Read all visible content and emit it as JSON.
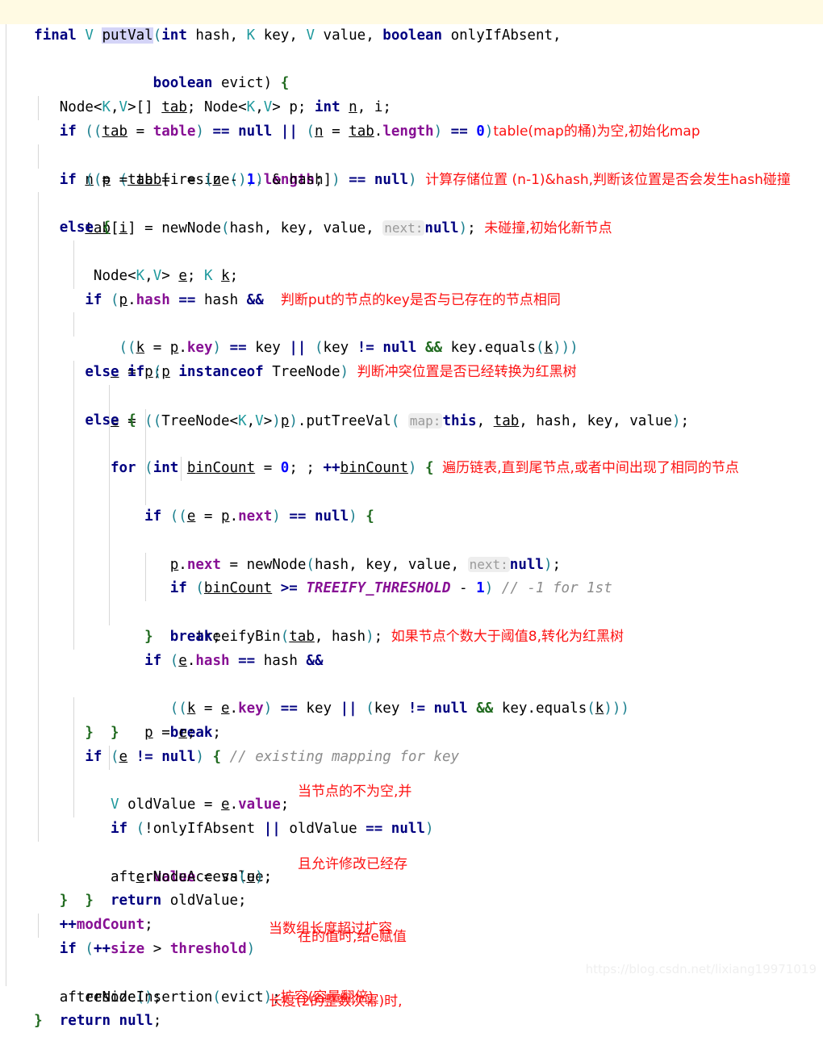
{
  "app": {
    "kind": "code-editor",
    "language": "Java",
    "theme": "IntelliJ Light",
    "watermark": "https://blog.csdn.net/lixiang19971019",
    "colors": {
      "background": "#ffffff",
      "caret_line": "#fffae3",
      "keyword": "#000080",
      "field": "#871094",
      "type_param": "#20999d",
      "number": "#0000ff",
      "comment": "#8c8c8c",
      "paren": "#1a7f8e",
      "brace": "#216b20",
      "inlay_hint_bg": "#eeeeee",
      "inlay_hint_text": "#9a9a9a",
      "selection": "#d4d4f7",
      "annotation_red": "#fd1212",
      "indent_guide": "#d7d7d7"
    }
  },
  "code": {
    "line_1": {
      "kw_final": "final",
      "type_v": "V",
      "name": "putVal",
      "open": "(",
      "kw_int": "int",
      "p1": "hash,",
      "type_k": "K",
      "p2": "key,",
      "type_v2": "V",
      "p3": "value,",
      "kw_boolean": "boolean",
      "p4": "onlyIfAbsent,"
    },
    "line_2": {
      "kw_boolean": "boolean",
      "p": "evict)",
      "brace": "{"
    },
    "line_3": {
      "t1": "Node<",
      "k": "K",
      "c1": ",",
      "v": "V",
      "c2": ">[]",
      "tab": "tab",
      "semi1": ";",
      "t2": "Node<",
      "k2": "K",
      "c3": ",",
      "v2": "V",
      "c4": ">",
      "p": "p",
      "semi2": ";",
      "kw_int": "int",
      "n": "n",
      "comma": ",",
      "i": "i",
      "semi3": ";"
    },
    "line_4": {
      "kw_if": "if",
      "o": "((",
      "tab": "tab",
      "eq": "=",
      "table": "table",
      "cl": ")",
      "eqeq": "==",
      "nul": "null",
      "or": "||",
      "o2": "(",
      "n": "n",
      "eq2": "=",
      "tab2": "tab",
      "dot": ".",
      "length": "length",
      "cl2": ")",
      "eqeq2": "==",
      "zero": "0",
      "cl3": ")",
      "note": "table(map的桶)为空,初始化map"
    },
    "line_5": {
      "n": "n",
      "eq": "=",
      "o": "(",
      "tab": "tab",
      "eq2": "=",
      "resize": "resize",
      "parens": "()",
      "cl": ")",
      "dot": ".",
      "length": "length",
      "semi": ";"
    },
    "line_6": {
      "kw_if": "if",
      "o": "((",
      "p": "p",
      "eq": "=",
      "tab": "tab",
      "br1": "[",
      "i": "i",
      "eq2": "=",
      "o2": "(",
      "n": "n",
      "minus": "-",
      "one": "1",
      "cl2": ")",
      "amp": "&",
      "hash": "hash",
      "br2": "]",
      "cl3": ")",
      "eqeq": "==",
      "nul": "null",
      "cl4": ")",
      "note": "计算存储位置 (n-1)&hash,判断该位置是否会发生hash碰撞"
    },
    "line_7": {
      "tab": "tab",
      "br1": "[",
      "i": "i",
      "br2": "]",
      "eq": "=",
      "newNode": "newNode",
      "o": "(",
      "args": "hash, key, value,",
      "hint": "next:",
      "nul": "null",
      "cl": ")",
      "semi": ";",
      "note": "未碰撞,初始化新节点"
    },
    "line_8": {
      "kw_else": "else",
      "brace": "{"
    },
    "line_9": {
      "t1": "Node<",
      "k": "K",
      "c1": ",",
      "v": "V",
      "c2": ">",
      "e": "e",
      "semi1": ";",
      "k2": "K",
      "kk": "k",
      "semi2": ";"
    },
    "line_10": {
      "kw_if": "if",
      "o": "(",
      "p": "p",
      "dot": ".",
      "hash": "hash",
      "eqeq": "==",
      "hash2": "hash",
      "and": "&&",
      "note": "判断put的节点的key是否与已存在的节点相同"
    },
    "line_11": {
      "o": "((",
      "k": "k",
      "eq": "=",
      "p": "p",
      "dot": ".",
      "key": "key",
      "cl": ")",
      "eqeq": "==",
      "key2": "key",
      "or": "||",
      "o2": "(",
      "key3": "key",
      "neq": "!=",
      "nul": "null",
      "and": "&&",
      "key4": "key",
      "dot2": ".",
      "equals": "equals",
      "o3": "(",
      "k2": "k",
      "cl2": ")))"
    },
    "line_12": {
      "e": "e",
      "eq": "=",
      "p": "p",
      "semi": ";"
    },
    "line_13": {
      "kw_else": "else",
      "kw_if": "if",
      "o": "(",
      "p": "p",
      "kw_instanceof": "instanceof",
      "treenode": "TreeNode",
      "cl": ")",
      "note": "判断冲突位置是否已经转换为红黑树"
    },
    "line_14": {
      "e": "e",
      "eq": "=",
      "o": "((",
      "treenode": "TreeNode<",
      "k": "K",
      "c1": ",",
      "v": "V",
      "c2": ">",
      "cl1": ")",
      "p": "p",
      "cl2": ")",
      "dot": ".",
      "putTreeVal": "putTreeVal",
      "o2": "(",
      "hint": "map:",
      "kw_this": "this",
      "args": ", tab, hash, key, value",
      "cl3": ")",
      "semi": ";"
    },
    "line_15": {
      "kw_else": "else",
      "brace": "{"
    },
    "line_16": {
      "kw_for": "for",
      "o": "(",
      "kw_int": "int",
      "binCount": "binCount",
      "eq": "=",
      "zero": "0",
      "semi1": ";",
      "semi2": ";",
      "inc": "++",
      "binCount2": "binCount",
      "cl": ")",
      "brace": "{",
      "note": "遍历链表,直到尾节点,或者中间出现了相同的节点"
    },
    "line_17": {
      "kw_if": "if",
      "o": "((",
      "e": "e",
      "eq": "=",
      "p": "p",
      "dot": ".",
      "next": "next",
      "cl": ")",
      "eqeq": "==",
      "nul": "null",
      "cl2": ")",
      "brace": "{"
    },
    "line_18": {
      "p": "p",
      "dot": ".",
      "next": "next",
      "eq": "=",
      "newNode": "newNode",
      "o": "(",
      "args": "hash, key, value,",
      "hint": "next:",
      "nul": "null",
      "cl": ")",
      "semi": ";"
    },
    "line_19": {
      "kw_if": "if",
      "o": "(",
      "binCount": "binCount",
      "gte": ">=",
      "threshold": "TREEIFY_THRESHOLD",
      "minus": "-",
      "one": "1",
      "cl": ")",
      "comment": "// -1 for 1st"
    },
    "line_20": {
      "treeifyBin": "treeifyBin",
      "o": "(",
      "tab": "tab",
      "comma": ",",
      "hash": "hash",
      "cl": ")",
      "semi": ";",
      "note": "如果节点个数大于阈值8,转化为红黑树"
    },
    "line_21": {
      "kw_break": "break",
      "semi": ";"
    },
    "line_22": {
      "brace": "}"
    },
    "line_23": {
      "kw_if": "if",
      "o": "(",
      "e": "e",
      "dot": ".",
      "hash": "hash",
      "eqeq": "==",
      "hash2": "hash",
      "and": "&&"
    },
    "line_24": {
      "o": "((",
      "k": "k",
      "eq": "=",
      "e": "e",
      "dot": ".",
      "key": "key",
      "cl": ")",
      "eqeq": "==",
      "key2": "key",
      "or": "||",
      "o2": "(",
      "key3": "key",
      "neq": "!=",
      "nul": "null",
      "and": "&&",
      "key4": "key",
      "dot2": ".",
      "equals": "equals",
      "o3": "(",
      "k2": "k",
      "cl2": ")))"
    },
    "line_25": {
      "kw_break": "break",
      "semi": ";"
    },
    "line_26": {
      "p": "p",
      "eq": "=",
      "e": "e",
      "semi": ";"
    },
    "line_27": {
      "brace": "}"
    },
    "line_28": {
      "brace": "}"
    },
    "line_29": {
      "kw_if": "if",
      "o": "(",
      "e": "e",
      "neq": "!=",
      "nul": "null",
      "cl": ")",
      "brace": "{",
      "comment": "// existing mapping for key"
    },
    "line_30": {
      "v": "V",
      "oldValue": "oldValue",
      "eq": "=",
      "e": "e",
      "dot": ".",
      "value": "value",
      "semi": ";"
    },
    "line_31": {
      "kw_if": "if",
      "o": "(",
      "bang": "!",
      "onlyIfAbsent": "onlyIfAbsent",
      "or": "||",
      "oldValue": "oldValue",
      "eqeq": "==",
      "nul": "null",
      "cl": ")"
    },
    "line_32": {
      "e": "e",
      "dot": ".",
      "value": "value",
      "eq": "=",
      "value2": "value",
      "semi": ";"
    },
    "line_33": {
      "afterNodeAccess": "afterNodeAccess",
      "o": "(",
      "e": "e",
      "cl": ")",
      "semi": ";"
    },
    "line_34": {
      "kw_return": "return",
      "oldValue": "oldValue",
      "semi": ";"
    },
    "line_35": {
      "brace": "}"
    },
    "line_36": {
      "brace": "}"
    },
    "line_37": {
      "inc": "++",
      "modCount": "modCount",
      "semi": ";"
    },
    "line_38": {
      "kw_if": "if",
      "o": "(",
      "inc": "++",
      "size": "size",
      "gt": ">",
      "threshold": "threshold",
      "cl": ")"
    },
    "line_39": {
      "resize": "resize",
      "parens": "()",
      "semi": ";"
    },
    "line_40": {
      "afterNodeInsertion": "afterNodeInsertion",
      "o": "(",
      "evict": "evict",
      "cl": ")",
      "semi": ";",
      "note": "扩容(容量翻倍)"
    },
    "line_41": {
      "kw_return": "return",
      "nul": "null",
      "semi": ";"
    },
    "line_42": {
      "brace": "}"
    }
  },
  "annotations": {
    "value_note_l1": "当节点的不为空,并",
    "value_note_l2": "且允许修改已经存",
    "value_note_l3": "在的值时,给e赋值",
    "resize_note_l1": "当数组长度超过扩容",
    "resize_note_l2": "长度(2的整数次幂)时,"
  }
}
